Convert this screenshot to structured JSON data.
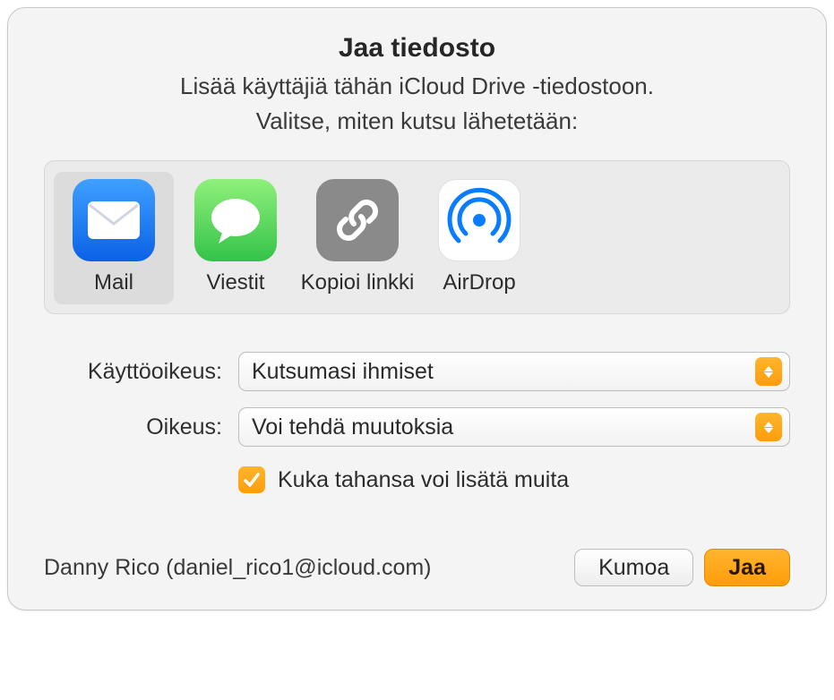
{
  "header": {
    "title": "Jaa tiedosto",
    "subtitle": "Lisää käyttäjiä tähän iCloud Drive -tiedostoon.",
    "choose": "Valitse, miten kutsu lähetetään:"
  },
  "share_options": [
    {
      "id": "mail",
      "label": "Mail",
      "selected": true
    },
    {
      "id": "messages",
      "label": "Viestit",
      "selected": false
    },
    {
      "id": "copylink",
      "label": "Kopioi linkki",
      "selected": false
    },
    {
      "id": "airdrop",
      "label": "AirDrop",
      "selected": false
    }
  ],
  "form": {
    "access_label": "Käyttöoikeus:",
    "access_value": "Kutsumasi ihmiset",
    "permission_label": "Oikeus:",
    "permission_value": "Voi tehdä muutoksia",
    "checkbox_label": "Kuka tahansa voi lisätä muita",
    "checkbox_checked": true
  },
  "footer": {
    "user": "Danny Rico (daniel_rico1@icloud.com)",
    "cancel": "Kumoa",
    "share": "Jaa"
  },
  "colors": {
    "accent": "#ff9d0a"
  }
}
